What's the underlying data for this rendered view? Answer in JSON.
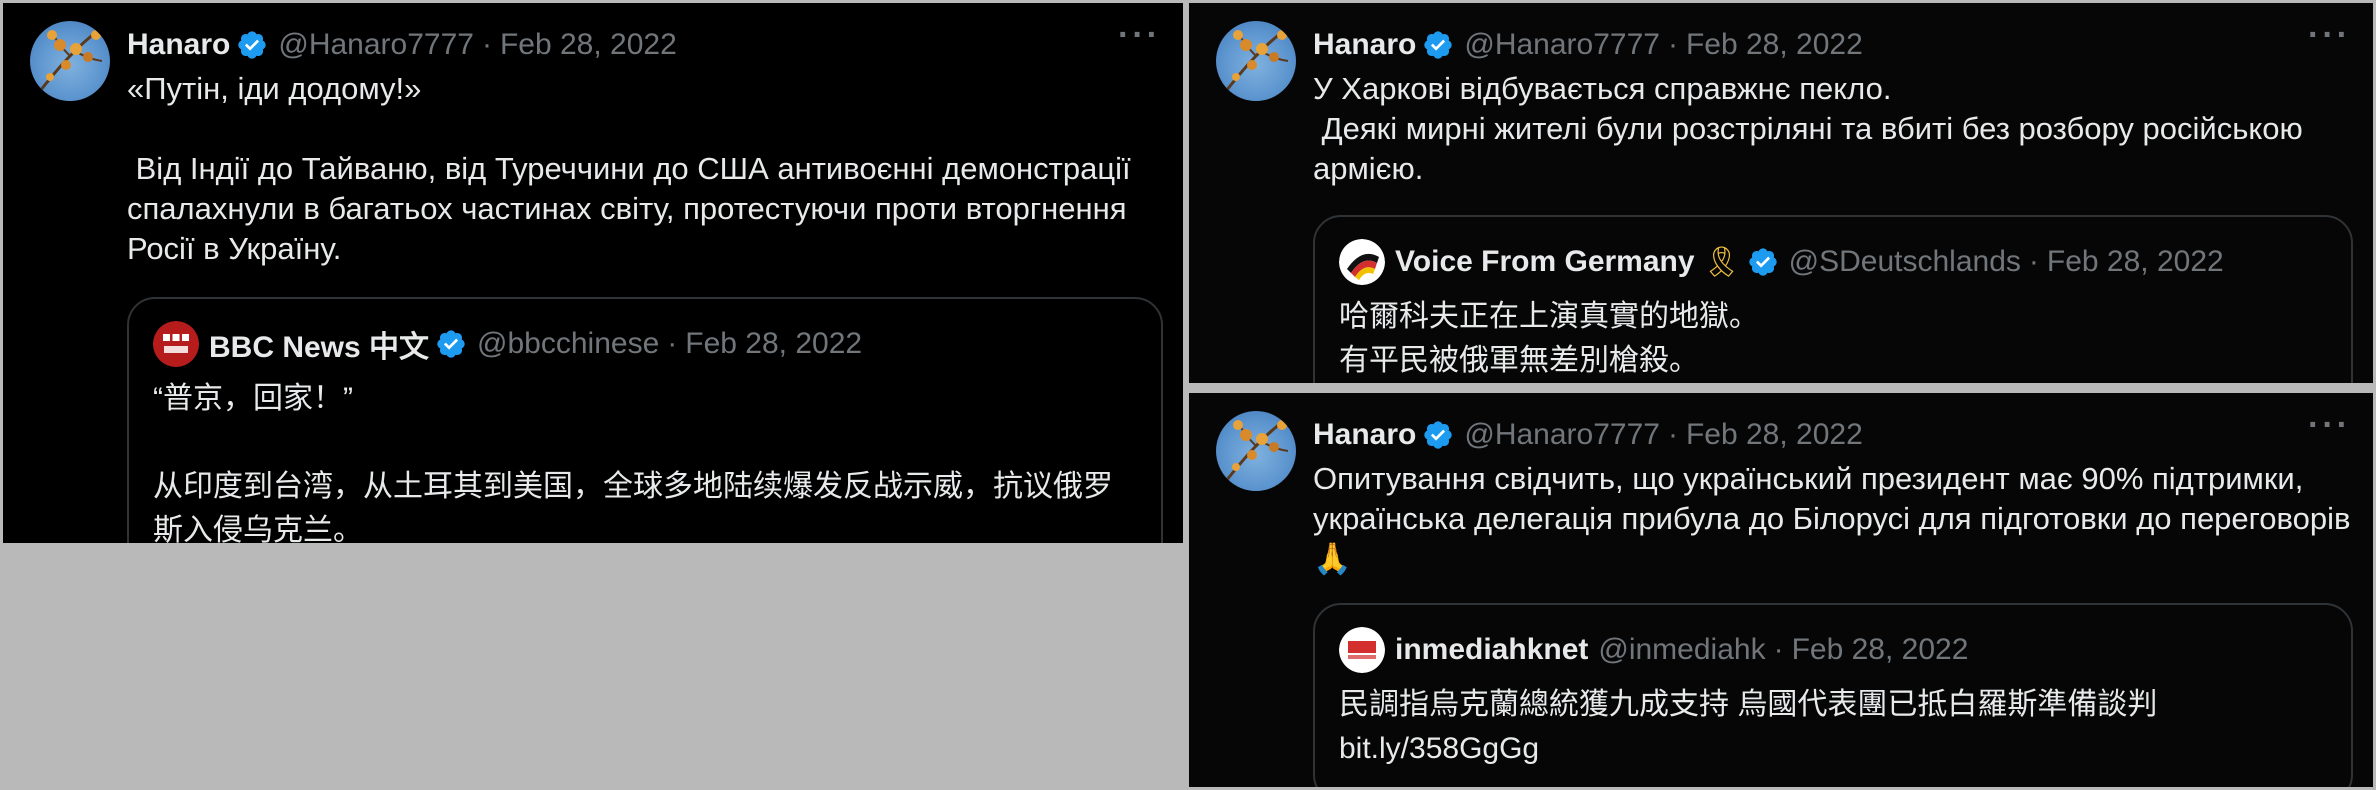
{
  "colors": {
    "background": "#000000",
    "text": "#e7e9ea",
    "muted": "#71767b",
    "verified": "#1d9bf0",
    "border": "#2f3336"
  },
  "tweets": [
    {
      "author": "Hanaro",
      "handle": "@Hanaro7777",
      "separator": "·",
      "date": "Feb 28, 2022",
      "more_icon": "more-icon",
      "more_label": "···",
      "text": "«Путін, іди додому!»\n\n Від Індії до Тайваню, від Туреччини до США антивоєнні демонстрації спалахнули в багатьох частинах світу, протестуючи проти вторгнення Росії в Україну.",
      "quote": {
        "author": "BBC News 中文",
        "handle": "@bbcchinese",
        "separator": "·",
        "date": "Feb 28, 2022",
        "text": "“普京，回家！”\n\n从印度到台湾，从土耳其到美国，全球多地陆续爆发反战示威，抗议俄罗斯入侵乌克兰。"
      }
    },
    {
      "author": "Hanaro",
      "handle": "@Hanaro7777",
      "separator": "·",
      "date": "Feb 28, 2022",
      "more_label": "···",
      "text": "У Харкові відбувається справжнє пекло.\n Деякі мирні жителі були розстріляні та вбиті без розбору російською армією.",
      "quote": {
        "author": "Voice From Germany",
        "ribbon": "🎗",
        "handle": "@SDeutschlands",
        "separator": "·",
        "date": "Feb 28, 2022",
        "text": "哈爾科夫正在上演真實的地獄。\n有平民被俄軍無差別槍殺。"
      }
    },
    {
      "author": "Hanaro",
      "handle": "@Hanaro7777",
      "separator": "·",
      "date": "Feb 28, 2022",
      "more_label": "···",
      "text": "Опитування свідчить, що український президент має 90% підтримки, українська делегація прибула до Білорусі для підготовки до переговорів🙏",
      "quote": {
        "author": "inmediahknet",
        "handle": "@inmediahk",
        "separator": "·",
        "date": "Feb 28, 2022",
        "text": "民調指烏克蘭總統獲九成支持 烏國代表團已抵白羅斯準備談判\nbit.ly/358GgGg"
      }
    }
  ]
}
